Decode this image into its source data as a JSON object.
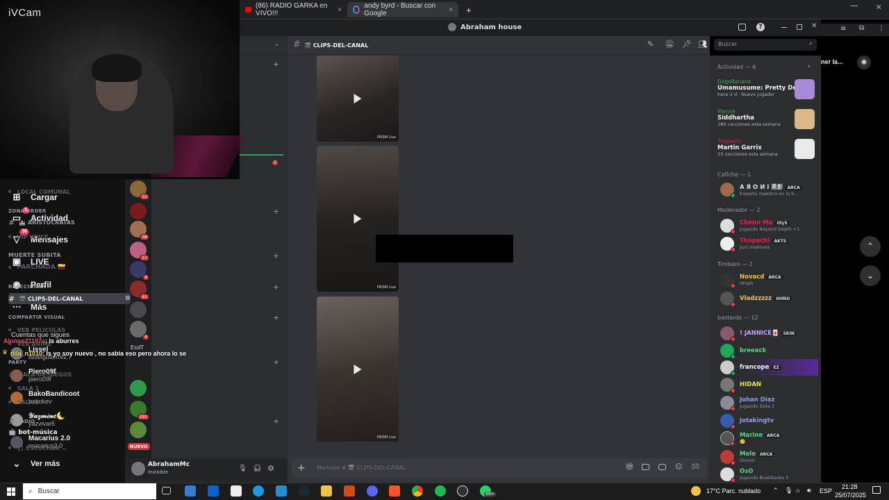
{
  "browser": {
    "tabs": [
      {
        "label": "(86) RADIO GARKA en VIVO!!!",
        "close": "×"
      },
      {
        "label": "andy byrd - Buscar con Google",
        "close": "×"
      }
    ],
    "new_tab": "+"
  },
  "window": {
    "title": "Abraham house"
  },
  "camera": {
    "brand": "iVCam"
  },
  "tiktok": {
    "menu": [
      {
        "label": "Cargar",
        "badge": ""
      },
      {
        "label": "Actividad",
        "badge": "5"
      },
      {
        "label": "Mensajes",
        "badge": "36"
      },
      {
        "label": "LIVE",
        "badge": ""
      },
      {
        "label": "Perfil",
        "badge": ""
      },
      {
        "label": "Más",
        "badge": ""
      }
    ],
    "following_title": "Cuentas que sigues",
    "following": [
      {
        "name": "Lissel",
        "handle": "lisselgutierrez.7"
      },
      {
        "name": "Piero09f",
        "handle": "piero09f"
      },
      {
        "name": "BakoBandicoot",
        "handle": "bakokev"
      },
      {
        "name": "𝒴𝒶𝓏𝓂𝒾𝓃𝑒🌜",
        "handle": "yazvivar6"
      },
      {
        "name": "Macarius 2.0",
        "handle": "macarius2.0_"
      }
    ],
    "see_more": "Ver más",
    "chat": [
      {
        "user": "Alonso21107a",
        "text": ": ls aburres"
      },
      {
        "user": "dila_n1010",
        "text": ": ls yo soy nuevo , no sabía eso pero ahora lo se"
      }
    ]
  },
  "servers": {
    "badges": [
      "52",
      "38",
      "57",
      "4",
      "61",
      "4",
      "291"
    ],
    "label_esdt": "EsdT",
    "nuevo": "NUEVO"
  },
  "channels": {
    "header_badge": "3",
    "items": [
      {
        "type": "voice",
        "name": "LOCAL COMUNAL"
      },
      {
        "type": "category",
        "name": "ZONA BROER"
      },
      {
        "type": "text",
        "name": "🏰 ARISTOCRATAS"
      },
      {
        "type": "voice",
        "name": "VIP VOICE"
      },
      {
        "type": "category-big",
        "name": "MUERTE SUBITA"
      },
      {
        "type": "voice",
        "name": "PARCHADA 🇨🇴"
      },
      {
        "type": "category",
        "name": "REACCIONAR"
      },
      {
        "type": "selected",
        "name": "🎬 CLIPS-DEL-CANAL"
      },
      {
        "type": "category",
        "name": "COMPARTIR VISUAL"
      },
      {
        "type": "voice",
        "name": "VER PELICULAS"
      },
      {
        "type": "voice",
        "name": "VER ANIME"
      },
      {
        "type": "category",
        "name": "PARTY"
      },
      {
        "type": "text",
        "name": "SALA-DE-JUEGOS"
      },
      {
        "type": "voice",
        "name": "SALA 1"
      },
      {
        "type": "voice",
        "name": "SALA 2"
      },
      {
        "type": "category",
        "name": "🎵 RADIO"
      },
      {
        "type": "textw",
        "name": "🤖 bot-música"
      },
      {
        "type": "voice",
        "name": "🎵 ESCUCHAR"
      }
    ]
  },
  "user": {
    "name": "AbrahamMc",
    "status": "Invisible"
  },
  "main": {
    "channel_name": "🎬 CLIPS-DEL-CANAL",
    "composer_placeholder": "Mensaje # 🎬 CLIPS-DEL-CANAL",
    "watermark": "PRISM Live"
  },
  "search": {
    "placeholder": "Buscar"
  },
  "members": {
    "activity_title": "Actividad — 6",
    "activities": [
      {
        "user": "DogeBanane",
        "game": "Umamusume: Pretty Derby",
        "meta": "hace 2 d · Nuevo jugador",
        "color": "#3ba55d",
        "img": "#a88bd6"
      },
      {
        "user": "Marine",
        "game": "Siddhartha",
        "meta": "180 canciones esta semana",
        "color": "#3ba55d",
        "img": "#d8b788"
      },
      {
        "user": "Thopachi",
        "game": "Martin Garrix",
        "meta": "23 canciones esta semana",
        "color": "#e0224e",
        "img": "#ececec"
      }
    ],
    "sections": [
      {
        "title": "Cafiche — 1",
        "members": [
          {
            "name": "A Я O И I 黑影",
            "tag": "ARCA",
            "status": "Experto maestro en la ti...",
            "color": "#dbdee1",
            "online": true
          }
        ]
      },
      {
        "title": "Moderador — 2",
        "members": [
          {
            "name": "Chenn Ma",
            "tag": "OlyS",
            "status": "Jugando Beyond Depth +1",
            "color": "#e0224e",
            "online": false
          },
          {
            "name": "Thopachi",
            "tag": "AKTS",
            "status": "Just madness",
            "color": "#e0224e",
            "online": false
          }
        ]
      },
      {
        "title": "Timbero — 2",
        "members": [
          {
            "name": "Novacd",
            "tag": "ARCA",
            "status": "Hmph",
            "color": "#f0c246",
            "online": false
          },
          {
            "name": "Vladzzzzz",
            "tag": "OHÑO",
            "status": "",
            "color": "#f0c246",
            "online": false
          }
        ]
      },
      {
        "title": "bastardo — 12",
        "members": [
          {
            "name": "! JANNICE🀄",
            "tag": "SKIN",
            "status": "",
            "color": "#c0a3ff",
            "online": false
          },
          {
            "name": "breeack",
            "tag": "",
            "status": "",
            "color": "#5ad67d",
            "online": true
          },
          {
            "name": "francope",
            "tag": "EZ",
            "status": "",
            "color": "#f2f3f5",
            "online": true
          },
          {
            "name": "HIDAN",
            "tag": "",
            "status": "",
            "color": "#f0e35a",
            "online": false
          },
          {
            "name": "Johan Diaz",
            "tag": "",
            "status": "Jugando Dota 2",
            "color": "#8ea1e1",
            "online": false
          },
          {
            "name": "Jotakingtv",
            "tag": "",
            "status": "",
            "color": "#8ea1e1",
            "online": false
          },
          {
            "name": "Marine",
            "tag": "ARCA",
            "status": "🙂",
            "color": "#5ad67d",
            "online": false
          },
          {
            "name": "Mole",
            "tag": "ARCA",
            "status": "Dormir",
            "color": "#5ad67d",
            "online": false
          },
          {
            "name": "OsO",
            "tag": "",
            "status": "Jugando BlueStacks 5",
            "color": "#5ad67d",
            "online": false
          }
        ]
      }
    ]
  },
  "right_panel": {
    "label": "ner la..."
  },
  "taskbar": {
    "search": "Buscar",
    "weather": "17°C  Parc. nublado",
    "lang": "ESP",
    "time": "21:28",
    "date": "25/07/2025",
    "badge": "99+"
  }
}
